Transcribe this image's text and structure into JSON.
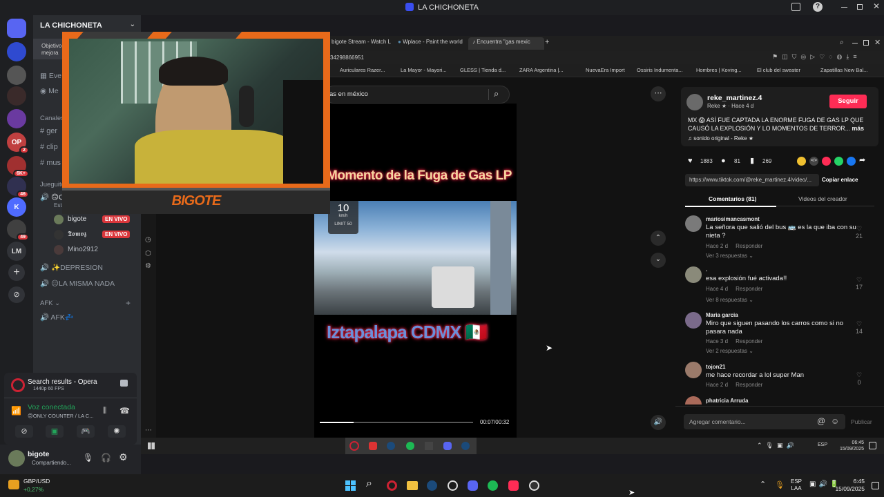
{
  "window": {
    "title": "LA CHICHONETA"
  },
  "server": {
    "name": "LA CHICHONETA",
    "banner_text": "Objetivo",
    "banner_sub": "mejora"
  },
  "servers": [
    {
      "label": "",
      "badge": "",
      "color": "#5865f2",
      "icon": "discord-logo"
    },
    {
      "label": "",
      "badge": "",
      "color": "#2f4ad0",
      "icon": "la-chichoneta-server"
    },
    {
      "label": "",
      "badge": "",
      "color": "#555",
      "icon": "server-avatar"
    },
    {
      "label": "",
      "badge": "",
      "color": "#3a2a2a",
      "icon": "server-avatar"
    },
    {
      "label": "",
      "badge": "",
      "color": "#6a3aa0",
      "icon": "server-avatar"
    },
    {
      "label": "OP",
      "badge": "2",
      "color": "#c04040",
      "icon": "server-avatar"
    },
    {
      "label": "",
      "badge": "6K+",
      "color": "#a03030",
      "icon": "server-avatar"
    },
    {
      "label": "",
      "badge": "46",
      "color": "#303050",
      "icon": "server-avatar"
    },
    {
      "label": "K",
      "badge": "",
      "color": "#4f6bff",
      "icon": "server-avatar"
    },
    {
      "label": "",
      "badge": "49",
      "color": "#404040",
      "icon": "server-avatar"
    },
    {
      "label": "LM",
      "badge": "",
      "color": "#313338",
      "icon": "server-avatar"
    }
  ],
  "sidebar": {
    "events": "Eve",
    "members": "Me",
    "text_category": "Canales",
    "text_channels": [
      "ger",
      "clip",
      "mus"
    ],
    "voice_category": "Jueguitos",
    "voice_channel_1": "🙃O",
    "voice_channel_1_sub": "Esta",
    "voice_users": [
      {
        "name": "bigote",
        "live": "EN VIVO"
      },
      {
        "name": "𝕿𝖔𝖒𝖛𝖟",
        "live": "EN VIVO"
      },
      {
        "name": "Mino2912",
        "live": ""
      }
    ],
    "voice_channel_2": "✨DEPRESION",
    "voice_channel_3": "😐LA MISMA NADA",
    "afk_category": "AFK",
    "afk_channel": "AFK💤"
  },
  "voice_panel": {
    "activity_title": "Search results - Opera",
    "activity_sub": "1440p 60 FPS",
    "status": "Voz conectada",
    "channel": "🙃ONLY COUNTER / LA C..."
  },
  "user": {
    "name": "bigote",
    "status": "Compartiendo..."
  },
  "browser": {
    "tabs": [
      "bigote Stream - Watch L",
      "Wplace - Paint the world",
      "Encuentra \"gas mexic"
    ],
    "url_fragment": "34298866951",
    "bookmarks": [
      "Auriculares Razer...",
      "La Mayor - Mayori...",
      "GLESS | Tienda d...",
      "ZARA Argentina |...",
      "NuevaEra Import",
      "Ossiris Indumenta...",
      "Hombres | Koving...",
      "El club del sweater",
      "Zapatillas New Bal..."
    ],
    "search_text": "as en méxico"
  },
  "video": {
    "caption_top": "Momento de la Fuga de Gas LP",
    "caption_bottom": "Iztapalapa CDMX 🇲🇽",
    "speed_value": "10",
    "speed_unit": "km/h",
    "speed_limit": "LIMIT 50",
    "time": "00:07/00:32",
    "progress": 0.22
  },
  "post": {
    "author": "reke_martinez.4",
    "author_sub": "Reke ★ · Hace 4 d",
    "follow_label": "Seguir",
    "caption": "MX 😱 ASÍ FUE CAPTADA LA ENORME FUGA DE GAS LP QUE CAUSÓ LA EXPLOSIÓN Y LO MOMENTOS DE TERROR...",
    "more_label": "más",
    "sound": "sonido original - Reke ★",
    "likes": "1883",
    "comments_count": "81",
    "saves": "269",
    "link": "https://www.tiktok.com/@reke_martinez.4/video/...",
    "copy_label": "Copiar enlace",
    "tab_comments": "Comentarios (81)",
    "tab_videos": "Videos del creador",
    "comment_placeholder": "Agregar comentario...",
    "publish_label": "Publicar"
  },
  "comments": [
    {
      "user": "mariosimancasmont",
      "text": "La señora que salió del bus 🚌 es la que iba con su nieta ?",
      "meta": "Hace 2 d",
      "reply": "Responder",
      "more": "Ver 3 respuestas",
      "likes": "21"
    },
    {
      "user": ".",
      "text": "esa explosión fué activada!!",
      "meta": "Hace 4 d",
      "reply": "Responder",
      "more": "Ver 8 respuestas",
      "likes": "17"
    },
    {
      "user": "Maria garcia",
      "text": "Miro que siguen pasando los carros como si no pasara nada",
      "meta": "Hace 3 d",
      "reply": "Responder",
      "more": "Ver 2 respuestas",
      "likes": "14"
    },
    {
      "user": "tojon21",
      "text": "me hace recordar a lol super Man",
      "meta": "Hace 2 d",
      "reply": "Responder",
      "more": "",
      "likes": "0"
    },
    {
      "user": "phatricia Arruda",
      "text": "",
      "meta": "",
      "reply": "",
      "more": "",
      "likes": ""
    }
  ],
  "overlay": {
    "streamer_name": "BIGOTE"
  },
  "inner_tray": {
    "lang": "ESP",
    "time": "06:45",
    "date": "15/09/2025"
  },
  "taskbar": {
    "ticker_name": "GBP/USD",
    "ticker_change": "+0,27%",
    "lang_1": "ESP",
    "lang_2": "LAA",
    "time": "6:45",
    "date": "15/09/2025"
  },
  "colors": {
    "discord_blurple": "#5865f2",
    "live_red": "#da373c",
    "tiktok_red": "#fe2c55",
    "overlay_orange": "#e86a1a"
  }
}
